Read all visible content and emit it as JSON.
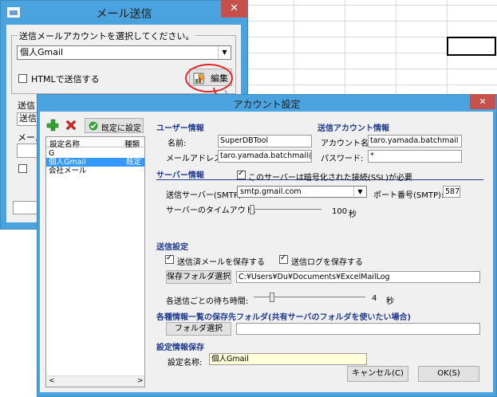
{
  "main_window": {
    "title": "メール送信",
    "close_label": "✕",
    "account_group_label": "送信メールアカウントを選択してください。",
    "selected_account": "個人Gmail",
    "html_checkbox_label": "HTMLで送信する",
    "edit_button_label": "編集",
    "partial_label_1": "送信",
    "partial_field_1": "送信",
    "partial_label_2": "メール"
  },
  "dialog": {
    "title": "アカウント設定",
    "close_label": "✕",
    "default_button_label": "既定に設定",
    "list_headers": [
      "設定名称",
      "種類"
    ],
    "list_items": [
      {
        "name": "G",
        "type": ""
      },
      {
        "name": "個人Gmail",
        "type": "既定"
      },
      {
        "name": "会社メール",
        "type": ""
      }
    ],
    "user_info": {
      "heading": "ユーザー情報",
      "name_label": "名前:",
      "name_value": "SuperDBTool",
      "email_label": "メールアドレス:",
      "email_value": "taro.yamada.batchmail@gmail.com"
    },
    "send_account": {
      "heading": "送信アカウント情報",
      "account_label": "アカウント名:",
      "account_value": "taro.yamada.batchmail",
      "password_label": "パスワード:",
      "password_value": "*"
    },
    "server_info": {
      "heading": "サーバー情報",
      "ssl_label": "このサーバーは暗号化された接続(SSL)が必要",
      "smtp_label": "送信サーバー(SMTP):",
      "smtp_value": "smtp.gmail.com",
      "port_label": "ポート番号(SMTP):",
      "port_value": "587",
      "timeout_label": "サーバーのタイムアウト:",
      "timeout_value": "100",
      "timeout_unit": "秒",
      "timeout_fraction": 0.0
    },
    "send_settings": {
      "heading": "送信設定",
      "save_sent_label": "送信済メールを保存する",
      "save_log_label": "送信ログを保存する",
      "save_folder_button": "保存フォルダ選択",
      "save_folder_value": "C:¥Users¥Du¥Documents¥ExcelMailLog",
      "wait_label": "各送信ごとの待ち時間:",
      "wait_value": "4",
      "wait_unit": "秒",
      "wait_fraction": 0.15
    },
    "shared_folder": {
      "heading": "各種情報一覧の保存先フォルダ(共有サーバのフォルダを使いたい場合)",
      "folder_button": "フォルダ選択",
      "folder_value": ""
    },
    "save_info": {
      "heading": "設定情報保存",
      "name_label": "設定名称:",
      "name_value": "個人Gmail"
    },
    "cancel_button": "キャンセル(C)",
    "ok_button": "OK(S)"
  },
  "colors": {
    "title_bar": "#4aa3df",
    "close": "#c7504b",
    "section_heading": "#1f3a8f",
    "selection": "#3399ff",
    "annotation": "#e0262a"
  }
}
